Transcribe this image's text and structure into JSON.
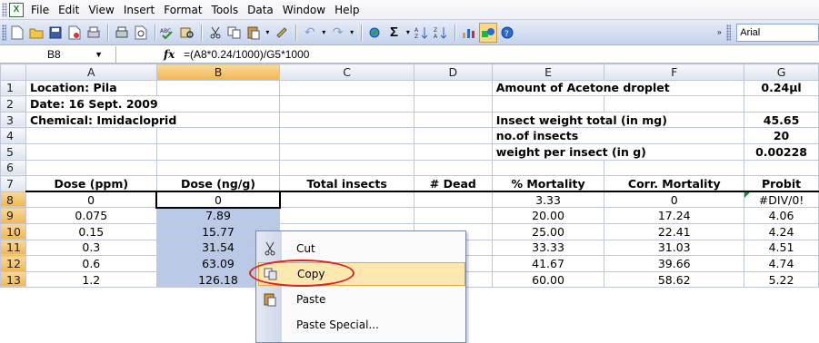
{
  "menubar": {
    "app_icon_glyph": "X",
    "items": [
      "File",
      "Edit",
      "View",
      "Insert",
      "Format",
      "Tools",
      "Data",
      "Window",
      "Help"
    ]
  },
  "toolbar": {
    "font_name": "Arial",
    "icons": [
      "new-icon",
      "open-icon",
      "save-icon",
      "permission-icon",
      "print-preview-icon",
      "print-icon",
      "preview-icon",
      "spelling-icon",
      "research-icon",
      "cut-icon",
      "copy-icon",
      "paste-icon",
      "format-painter-icon",
      "undo-icon",
      "redo-icon",
      "hyperlink-icon",
      "autosum-icon",
      "sort-ascending-icon",
      "sort-descending-icon",
      "chart-wizard-icon",
      "drawing-icon",
      "help-icon"
    ]
  },
  "formula_bar": {
    "name_box": "B8",
    "fx_label": "fx",
    "formula": "=(A8*0.24/1000)/G5*1000"
  },
  "columns": [
    "A",
    "B",
    "C",
    "D",
    "E",
    "F",
    "G"
  ],
  "rows": [
    "1",
    "2",
    "3",
    "4",
    "5",
    "6",
    "7",
    "8",
    "9",
    "10",
    "11",
    "12",
    "13"
  ],
  "cells": {
    "A1": "Location: Pila",
    "A2": "Date: 16 Sept. 2009",
    "A3": "Chemical: Imidacloprid",
    "E1": "Amount of Acetone droplet",
    "G1": "0.24µl",
    "E3": "Insect weight total (in mg)",
    "G3": "45.65",
    "E4": "no.of insects",
    "G4": "20",
    "E5": "weight per insect (in g)",
    "G5": "0.00228",
    "headers": [
      "Dose (ppm)",
      "Dose (ng/g)",
      "Total insects",
      "# Dead",
      "% Mortality",
      "Corr. Mortality",
      "Probit"
    ],
    "data": [
      [
        "0",
        "0",
        "",
        "",
        "3.33",
        "0",
        "#DIV/0!"
      ],
      [
        "0.075",
        "7.89",
        "",
        "",
        "20.00",
        "17.24",
        "4.06"
      ],
      [
        "0.15",
        "15.77",
        "",
        "",
        "25.00",
        "22.41",
        "4.24"
      ],
      [
        "0.3",
        "31.54",
        "",
        "",
        "33.33",
        "31.03",
        "4.51"
      ],
      [
        "0.6",
        "63.09",
        "",
        "",
        "41.67",
        "39.66",
        "4.74"
      ],
      [
        "1.2",
        "126.18",
        "",
        "",
        "60.00",
        "58.62",
        "5.22"
      ]
    ]
  },
  "context_menu": {
    "items": [
      {
        "label": "Cut",
        "icon": "scissors-icon"
      },
      {
        "label": "Copy",
        "icon": "copy-icon"
      },
      {
        "label": "Paste",
        "icon": "paste-icon"
      },
      {
        "label": "Paste Special...",
        "icon": ""
      }
    ]
  },
  "colors": {
    "selection": "#b9c9e6",
    "header_selected": "#f1b64f",
    "highlight_ring": "#e02020"
  }
}
